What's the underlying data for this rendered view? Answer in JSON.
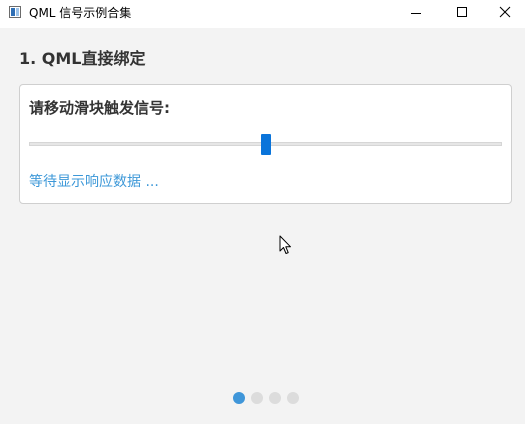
{
  "window": {
    "title": "QML 信号示例合集",
    "icon": "app-window-icon",
    "controls": [
      "minimize-icon",
      "maximize-icon",
      "close-icon"
    ]
  },
  "section": {
    "title": "1. QML直接绑定"
  },
  "card": {
    "prompt": "请移动滑块触发信号:",
    "slider": {
      "value_fraction": 0.5
    },
    "response_text": "等待显示响应数据 ..."
  },
  "pager": {
    "total": 4,
    "current_index": 0
  },
  "colors": {
    "accent": "#0a74da",
    "response_text": "#3d98d8",
    "active_dot": "#3f96d9",
    "inactive_dot": "#dcdcdc",
    "background": "#f3f3f3"
  }
}
